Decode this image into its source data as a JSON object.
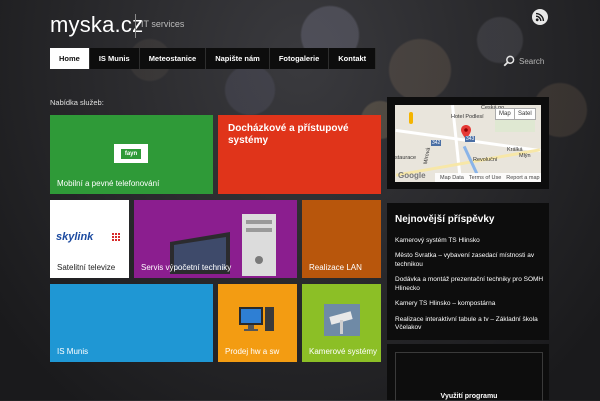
{
  "header": {
    "logo": "myska.cz",
    "tagline": "IT services",
    "rss_icon": "rss-icon"
  },
  "nav": {
    "items": [
      {
        "label": "Home",
        "active": true
      },
      {
        "label": "IS Munis"
      },
      {
        "label": "Meteostanice"
      },
      {
        "label": "Napište nám"
      },
      {
        "label": "Fotogalerie"
      },
      {
        "label": "Kontakt"
      }
    ]
  },
  "search": {
    "placeholder": "Search",
    "icon": "search-icon"
  },
  "services": {
    "title": "Nabídka služeb:",
    "tiles": [
      {
        "label": "Mobilní a pevné telefonování",
        "color": "#2f9a38",
        "logo_text": "fayn"
      },
      {
        "label": "Docházkové a přístupové systémy",
        "color": "#e0341a"
      },
      {
        "label": "Satelitní televize",
        "color": "#ffffff",
        "logo_text": "skylink"
      },
      {
        "label": "Servis výpočetní techniky",
        "color": "#8b1e8f"
      },
      {
        "label": "Realizace LAN",
        "color": "#b8560c"
      },
      {
        "label": "IS Munis",
        "color": "#1f97d4"
      },
      {
        "label": "Prodej hw a sw",
        "color": "#f39c12"
      },
      {
        "label": "Kamerové systémy",
        "color": "#8cbf26"
      }
    ]
  },
  "map": {
    "btn_map": "Map",
    "btn_sat": "Satel",
    "place_1": "Česká po",
    "place_2": "Hotel Podlesí",
    "place_3": "Revoluční",
    "place_4": "Králká",
    "place_5": "Mlýn",
    "place_6": "Mírová",
    "place_7": "staurace",
    "road_342": "342",
    "road_343": "343",
    "brand": "Google",
    "footer_1": "Map Data",
    "footer_2": "Terms of Use",
    "footer_3": "Report a map"
  },
  "posts": {
    "title": "Nejnovější příspěvky",
    "items": [
      "Kamerový systém TS Hlinsko",
      "Město Svratka – vybavení zasedací místnosti av technikou",
      "Dodávka a montáž prezentační techniky pro SOMH Hlinecko",
      "Kamery TS Hlinsko – kompostárna",
      "Realizace interaktivní tabule a tv – Základní škola Včelakov"
    ]
  },
  "promo": {
    "text": "Využití programu"
  },
  "colors": {
    "accent_red": "#e0341a",
    "nav_bg": "#0d0d0d"
  }
}
